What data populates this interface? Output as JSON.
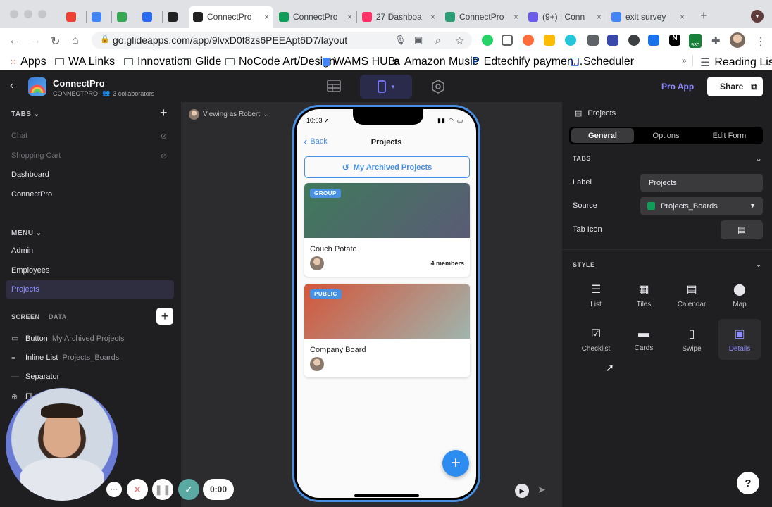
{
  "browser": {
    "tabs": [
      {
        "label": "",
        "icon": "gmail-icon",
        "color": "#ea4335"
      },
      {
        "label": "",
        "icon": "calendar-icon",
        "color": "#4285f4"
      },
      {
        "label": "",
        "icon": "drive-icon",
        "color": "#34a853"
      },
      {
        "label": "",
        "icon": "vpn-icon",
        "color": "#2b6bf2"
      },
      {
        "label": "",
        "icon": "glide-icon",
        "color": "#222222"
      },
      {
        "label": "ConnectPro",
        "icon": "glide-icon",
        "color": "#222222",
        "active": true
      },
      {
        "label": "ConnectPro",
        "icon": "sheets-icon",
        "color": "#0f9d58"
      },
      {
        "label": "27 Dashboa",
        "icon": "invision-icon",
        "color": "#ff3366"
      },
      {
        "label": "ConnectPro",
        "icon": "app-icon",
        "color": "#2e9c74"
      },
      {
        "label": "(9+) | Conn",
        "icon": "notion-icon",
        "color": "#6c5ce7"
      },
      {
        "label": "exit survey",
        "icon": "google-icon",
        "color": "#4285f4"
      }
    ],
    "url": "go.glideapps.com/app/9lvxD0f8zs6PEEApt6D7/layout",
    "bookmarks": [
      {
        "label": "Apps",
        "icon": "apps-grid-icon"
      },
      {
        "label": "WA Links",
        "icon": "folder-icon"
      },
      {
        "label": "Innovation",
        "icon": "folder-icon"
      },
      {
        "label": "Glide",
        "icon": "folder-icon"
      },
      {
        "label": "NoCode Art/Design",
        "icon": "folder-icon"
      },
      {
        "label": "WAMS HUB",
        "icon": "doc-icon"
      },
      {
        "label": "Amazon Music",
        "icon": "amazon-icon"
      },
      {
        "label": "Edtechify paymen...",
        "icon": "paypal-icon"
      },
      {
        "label": "Scheduler",
        "icon": "calendar-icon"
      }
    ],
    "reading_list": "Reading List",
    "more_bookmarks": "»",
    "ext_badge": "930"
  },
  "app": {
    "name": "ConnectPro",
    "subtitle": "CONNECTPRO",
    "collaborators": "3 collaborators",
    "pro_app": "Pro App",
    "share": "Share"
  },
  "left": {
    "tabs_header": "TABS",
    "tabs": [
      {
        "label": "Chat",
        "hidden": true
      },
      {
        "label": "Shopping Cart",
        "hidden": true
      },
      {
        "label": "Dashboard",
        "hidden": false
      },
      {
        "label": "ConnectPro",
        "hidden": false
      }
    ],
    "menu_header": "MENU",
    "menu": [
      "Admin",
      "Employees",
      "Projects"
    ],
    "screen_tab": "SCREEN",
    "data_tab": "DATA",
    "components": [
      {
        "type": "Button",
        "sub": "My Archived Projects",
        "icon": "button-icon"
      },
      {
        "type": "Inline List",
        "sub": "Projects_Boards",
        "icon": "list-icon"
      },
      {
        "type": "Separator",
        "sub": "",
        "icon": "separator-icon"
      },
      {
        "type": "Fl",
        "sub": "lew Board",
        "icon": "fab-icon"
      }
    ]
  },
  "canvas": {
    "viewing_as_prefix": "Viewing as",
    "viewing_as_user": "Robert"
  },
  "phone": {
    "time": "10:03",
    "back": "Back",
    "title": "Projects",
    "archived_button": "My Archived Projects",
    "cards": [
      {
        "badge": "GROUP",
        "title": "Couch Potato",
        "members": "4 members",
        "color_a": "#3f7a5c",
        "color_b": "#5a5b75"
      },
      {
        "badge": "PUBLIC",
        "title": "Company Board",
        "members": "",
        "color_a": "#d4553a",
        "color_b": "#9fb5ae"
      }
    ],
    "fab": "+"
  },
  "right": {
    "header": "Projects",
    "segments": [
      "General",
      "Options",
      "Edit Form"
    ],
    "active_segment": "General",
    "tabs_section": "TABS",
    "label_label": "Label",
    "label_value": "Projects",
    "source_label": "Source",
    "source_value": "Projects_Boards",
    "tab_icon_label": "Tab Icon",
    "style_section": "STYLE",
    "styles": [
      {
        "label": "List",
        "icon": "list-style-icon",
        "selected": false
      },
      {
        "label": "Tiles",
        "icon": "tiles-style-icon",
        "selected": false
      },
      {
        "label": "Calendar",
        "icon": "calendar-style-icon",
        "selected": false
      },
      {
        "label": "Map",
        "icon": "map-style-icon",
        "selected": false
      },
      {
        "label": "Checklist",
        "icon": "checklist-style-icon",
        "selected": false
      },
      {
        "label": "Cards",
        "icon": "cards-style-icon",
        "selected": false
      },
      {
        "label": "Swipe",
        "icon": "swipe-style-icon",
        "selected": false
      },
      {
        "label": "Details",
        "icon": "details-style-icon",
        "selected": true
      }
    ]
  },
  "recorder": {
    "timer": "0:00"
  },
  "help": "?"
}
